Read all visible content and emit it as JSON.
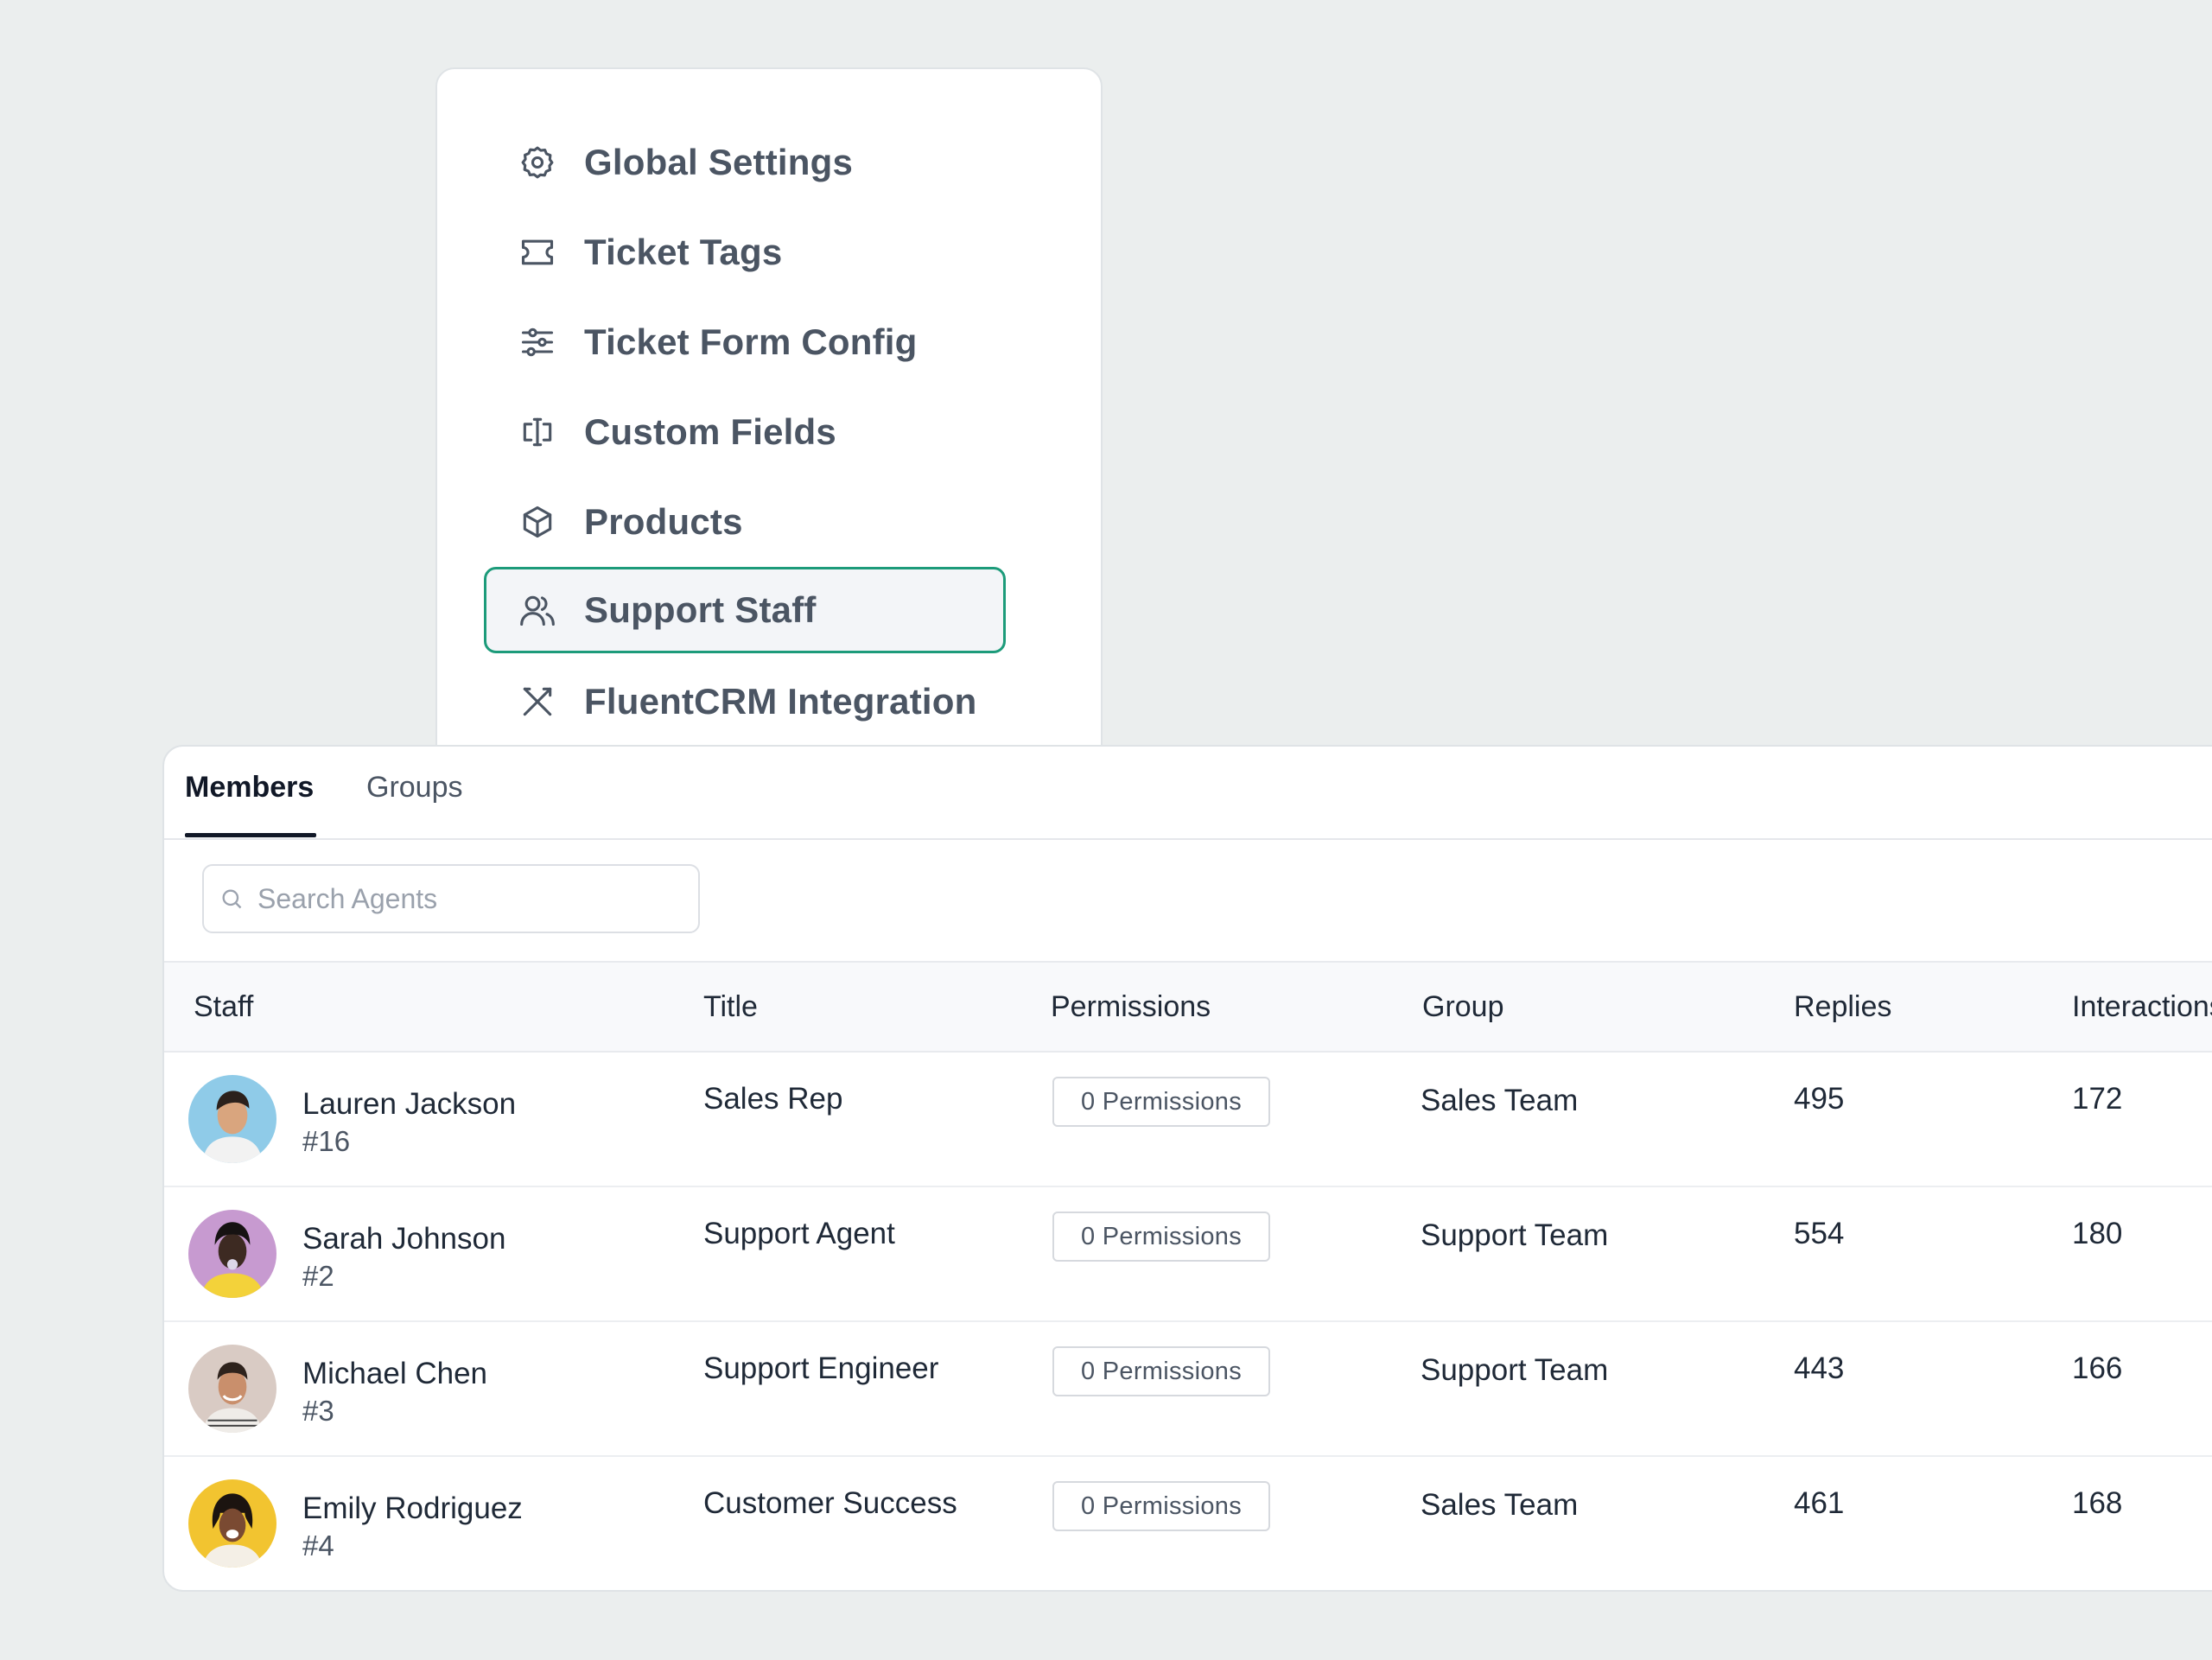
{
  "menu": {
    "items": [
      {
        "label": "Global Settings",
        "icon": "gear-icon",
        "active": false
      },
      {
        "label": "Ticket Tags",
        "icon": "ticket-icon",
        "active": false
      },
      {
        "label": "Ticket Form Config",
        "icon": "sliders-icon",
        "active": false
      },
      {
        "label": "Custom Fields",
        "icon": "text-cursor-icon",
        "active": false
      },
      {
        "label": "Products",
        "icon": "cube-icon",
        "active": false
      },
      {
        "label": "Support Staff",
        "icon": "users-icon",
        "active": true
      },
      {
        "label": "FluentCRM Integration",
        "icon": "tools-icon",
        "active": false
      }
    ],
    "accent_color": "#1c9b7a"
  },
  "tabs": {
    "members": "Members",
    "groups": "Groups",
    "active": "Members"
  },
  "search": {
    "placeholder": "Search Agents",
    "value": ""
  },
  "table": {
    "columns": {
      "staff": "Staff",
      "title": "Title",
      "permissions": "Permissions",
      "group": "Group",
      "replies": "Replies",
      "interactions": "Interactions"
    },
    "rows": [
      {
        "name": "Lauren Jackson",
        "id": "#16",
        "title": "Sales Rep",
        "permissions": "0 Permissions",
        "group": "Sales Team",
        "replies": "495",
        "interactions": "172",
        "avatar_bg": "#8fcbe8"
      },
      {
        "name": "Sarah Johnson",
        "id": "#2",
        "title": "Support Agent",
        "permissions": "0 Permissions",
        "group": "Support Team",
        "replies": "554",
        "interactions": "180",
        "avatar_bg": "#c79ad0"
      },
      {
        "name": "Michael Chen",
        "id": "#3",
        "title": "Support Engineer",
        "permissions": "0 Permissions",
        "group": "Support Team",
        "replies": "443",
        "interactions": "166",
        "avatar_bg": "#d9cbc4"
      },
      {
        "name": "Emily Rodriguez",
        "id": "#4",
        "title": "Customer Success",
        "permissions": "0 Permissions",
        "group": "Sales Team",
        "replies": "461",
        "interactions": "168",
        "avatar_bg": "#f2c430"
      }
    ]
  }
}
